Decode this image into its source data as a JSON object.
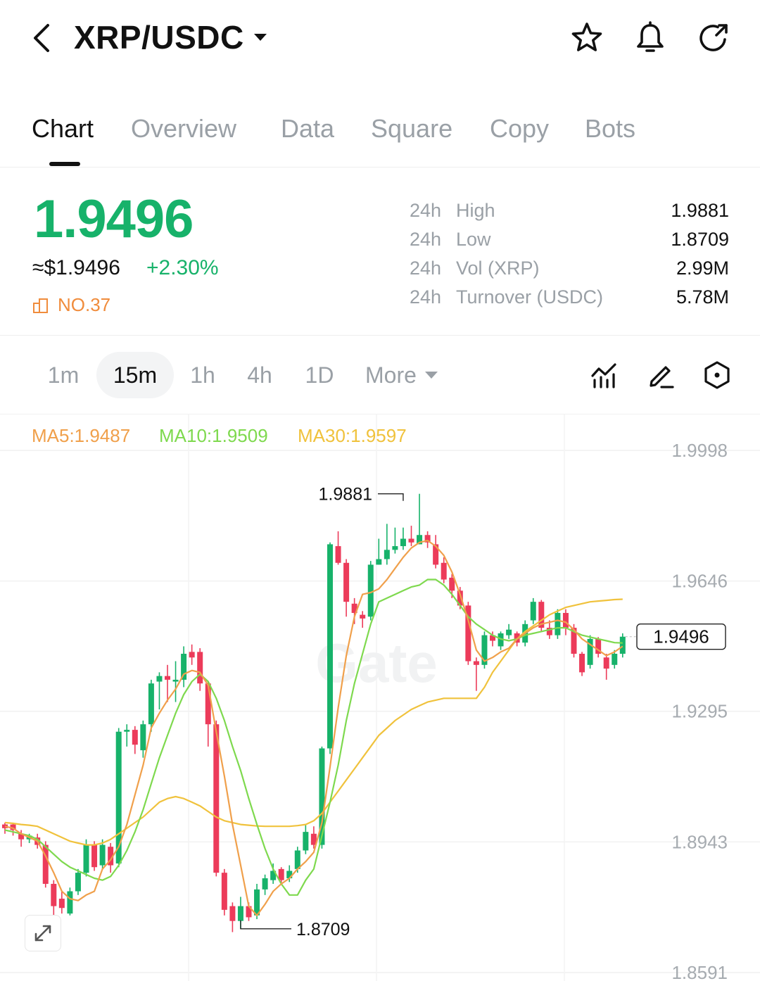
{
  "header": {
    "pair": "XRP/USDC",
    "icons": [
      "back-chevron-icon",
      "star-icon",
      "bell-icon",
      "share-icon"
    ]
  },
  "tabs": [
    {
      "label": "Chart",
      "active": true
    },
    {
      "label": "Overview",
      "active": false
    },
    {
      "label": "Data",
      "active": false
    },
    {
      "label": "Square",
      "active": false
    },
    {
      "label": "Copy",
      "active": false
    },
    {
      "label": "Bots",
      "active": false
    }
  ],
  "ticker": {
    "last_price": "1.9496",
    "usd_price": "≈$1.9496",
    "change": "+2.30%",
    "rank": "NO.37",
    "stats": [
      {
        "period": "24h",
        "label": "High",
        "value": "1.9881"
      },
      {
        "period": "24h",
        "label": "Low",
        "value": "1.8709"
      },
      {
        "period": "24h",
        "label": "Vol (XRP)",
        "value": "2.99M"
      },
      {
        "period": "24h",
        "label": "Turnover (USDC)",
        "value": "5.78M"
      }
    ]
  },
  "intervals": {
    "items": [
      {
        "label": "1m",
        "active": false
      },
      {
        "label": "15m",
        "active": true
      },
      {
        "label": "1h",
        "active": false
      },
      {
        "label": "4h",
        "active": false
      },
      {
        "label": "1D",
        "active": false
      }
    ],
    "more_label": "More",
    "tool_icons": [
      "indicator-icon",
      "draw-pencil-icon",
      "settings-hexagon-icon"
    ]
  },
  "colors": {
    "up": "#17b26a",
    "down": "#ec3b5a",
    "accent_green": "#17b26a",
    "rank_orange": "#f08c3c",
    "ma5": "#f0a04b",
    "ma10": "#7ed94e",
    "ma30": "#f0c23c"
  },
  "chart_data": {
    "type": "candlestick",
    "interval": "15m",
    "indicators": [
      {
        "name": "MA5",
        "label": "MA5:1.9487",
        "value": 1.9487
      },
      {
        "name": "MA10",
        "label": "MA10:1.9509",
        "value": 1.9509
      },
      {
        "name": "MA30",
        "label": "MA30:1.9597",
        "value": 1.9597
      }
    ],
    "y_ticks": [
      "1.9998",
      "1.9646",
      "1.9295",
      "1.8943",
      "1.8591"
    ],
    "ylim": [
      1.8591,
      1.9998
    ],
    "high_label": "1.9881",
    "high_value": 1.9881,
    "high_index": 49,
    "low_label": "1.8709",
    "low_value": 1.8709,
    "low_index": 29,
    "last_price_label": "1.9496",
    "last_price": 1.9496,
    "grid": true,
    "watermark": "Gate",
    "candles": [
      [
        1.899,
        1.898,
        1.8995,
        1.8965
      ],
      [
        1.899,
        1.8975,
        1.8995,
        1.896
      ],
      [
        1.8965,
        1.895,
        1.8975,
        1.893
      ],
      [
        1.895,
        1.896,
        1.8965,
        1.894
      ],
      [
        1.8955,
        1.8935,
        1.8965,
        1.8925
      ],
      [
        1.8935,
        1.883,
        1.8945,
        1.882
      ],
      [
        1.883,
        1.877,
        1.884,
        1.8735
      ],
      [
        1.879,
        1.8765,
        1.881,
        1.875
      ],
      [
        1.875,
        1.881,
        1.882,
        1.8745
      ],
      [
        1.881,
        1.886,
        1.887,
        1.88
      ],
      [
        1.886,
        1.8935,
        1.895,
        1.885
      ],
      [
        1.8935,
        1.8875,
        1.8945,
        1.8865
      ],
      [
        1.888,
        1.8935,
        1.895,
        1.887
      ],
      [
        1.893,
        1.888,
        1.894,
        1.886
      ],
      [
        1.8885,
        1.924,
        1.925,
        1.8875
      ],
      [
        1.924,
        1.9245,
        1.926,
        1.92
      ],
      [
        1.9245,
        1.9205,
        1.9255,
        1.918
      ],
      [
        1.919,
        1.926,
        1.927,
        1.917
      ],
      [
        1.926,
        1.937,
        1.938,
        1.924
      ],
      [
        1.9375,
        1.939,
        1.94,
        1.93
      ],
      [
        1.939,
        1.938,
        1.942,
        1.932
      ],
      [
        1.9375,
        1.938,
        1.943,
        1.932
      ],
      [
        1.938,
        1.945,
        1.947,
        1.936
      ],
      [
        1.9455,
        1.944,
        1.9475,
        1.942
      ],
      [
        1.9455,
        1.937,
        1.9465,
        1.935
      ],
      [
        1.937,
        1.926,
        1.9375,
        1.92
      ],
      [
        1.926,
        1.886,
        1.927,
        1.885
      ],
      [
        1.886,
        1.876,
        1.887,
        1.8745
      ],
      [
        1.877,
        1.873,
        1.878,
        1.87
      ],
      [
        1.873,
        1.877,
        1.8795,
        1.8709
      ],
      [
        1.877,
        1.874,
        1.878,
        1.873
      ],
      [
        1.8745,
        1.8815,
        1.883,
        1.8735
      ],
      [
        1.8815,
        1.8845,
        1.8855,
        1.88
      ],
      [
        1.884,
        1.8865,
        1.8885,
        1.883
      ],
      [
        1.887,
        1.884,
        1.8875,
        1.883
      ],
      [
        1.8845,
        1.8865,
        1.888,
        1.8835
      ],
      [
        1.887,
        1.892,
        1.893,
        1.886
      ],
      [
        1.892,
        1.897,
        1.899,
        1.891
      ],
      [
        1.8965,
        1.8935,
        1.8985,
        1.8925
      ],
      [
        1.8935,
        1.9195,
        1.92,
        1.8925
      ],
      [
        1.9195,
        1.9745,
        1.975,
        1.918
      ],
      [
        1.974,
        1.9695,
        1.978,
        1.969
      ],
      [
        1.9695,
        1.959,
        1.9705,
        1.955
      ],
      [
        1.9585,
        1.956,
        1.96,
        1.953
      ],
      [
        1.9555,
        1.9545,
        1.9565,
        1.952
      ],
      [
        1.955,
        1.969,
        1.97,
        1.954
      ],
      [
        1.969,
        1.9705,
        1.976,
        1.969
      ],
      [
        1.9705,
        1.973,
        1.98,
        1.969
      ],
      [
        1.973,
        1.974,
        1.979,
        1.972
      ],
      [
        1.974,
        1.976,
        1.979,
        1.973
      ],
      [
        1.976,
        1.975,
        1.9795,
        1.974
      ],
      [
        1.9745,
        1.977,
        1.9881,
        1.9745
      ],
      [
        1.977,
        1.975,
        1.978,
        1.9735
      ],
      [
        1.9745,
        1.969,
        1.977,
        1.968
      ],
      [
        1.9695,
        1.965,
        1.971,
        1.964
      ],
      [
        1.9655,
        1.962,
        1.9665,
        1.96
      ],
      [
        1.962,
        1.958,
        1.963,
        1.957
      ],
      [
        1.958,
        1.943,
        1.959,
        1.942
      ],
      [
        1.943,
        1.942,
        1.944,
        1.935
      ],
      [
        1.942,
        1.95,
        1.951,
        1.941
      ],
      [
        1.95,
        1.9485,
        1.951,
        1.947
      ],
      [
        1.947,
        1.9505,
        1.951,
        1.946
      ],
      [
        1.95,
        1.9515,
        1.953,
        1.949
      ],
      [
        1.9505,
        1.948,
        1.951,
        1.947
      ],
      [
        1.948,
        1.953,
        1.954,
        1.947
      ],
      [
        1.954,
        1.959,
        1.96,
        1.953
      ],
      [
        1.959,
        1.952,
        1.9595,
        1.951
      ],
      [
        1.952,
        1.95,
        1.954,
        1.949
      ],
      [
        1.95,
        1.956,
        1.957,
        1.949
      ],
      [
        1.956,
        1.952,
        1.957,
        1.95
      ],
      [
        1.952,
        1.945,
        1.953,
        1.944
      ],
      [
        1.945,
        1.94,
        1.9455,
        1.939
      ],
      [
        1.942,
        1.949,
        1.95,
        1.941
      ],
      [
        1.949,
        1.945,
        1.9495,
        1.944
      ],
      [
        1.944,
        1.941,
        1.945,
        1.938
      ],
      [
        1.942,
        1.945,
        1.946,
        1.941
      ],
      [
        1.945,
        1.9496,
        1.9505,
        1.944
      ]
    ],
    "ma5_series": [
      1.8985,
      1.898,
      1.8965,
      1.8955,
      1.8945,
      1.8905,
      1.886,
      1.881,
      1.879,
      1.8785,
      1.88,
      1.881,
      1.887,
      1.8895,
      1.893,
      1.899,
      1.907,
      1.915,
      1.925,
      1.929,
      1.9325,
      1.9355,
      1.9395,
      1.9405,
      1.94,
      1.9365,
      1.924,
      1.912,
      1.899,
      1.888,
      1.877,
      1.8745,
      1.8775,
      1.881,
      1.883,
      1.8845,
      1.887,
      1.889,
      1.8915,
      1.8995,
      1.9145,
      1.9305,
      1.9445,
      1.955,
      1.961,
      1.9615,
      1.9625,
      1.965,
      1.968,
      1.971,
      1.9735,
      1.975,
      1.9755,
      1.974,
      1.9715,
      1.967,
      1.961,
      1.954,
      1.946,
      1.943,
      1.944,
      1.9455,
      1.9465,
      1.949,
      1.9505,
      1.952,
      1.953,
      1.9535,
      1.954,
      1.9535,
      1.9515,
      1.949,
      1.9475,
      1.946,
      1.9445,
      1.9455,
      1.947
    ],
    "ma10_series": [
      1.8975,
      1.897,
      1.8965,
      1.896,
      1.895,
      1.893,
      1.891,
      1.889,
      1.8875,
      1.8865,
      1.8855,
      1.8845,
      1.884,
      1.885,
      1.888,
      1.892,
      1.897,
      1.903,
      1.91,
      1.917,
      1.923,
      1.929,
      1.934,
      1.9375,
      1.9395,
      1.9375,
      1.933,
      1.927,
      1.92,
      1.9135,
      1.906,
      1.899,
      1.8925,
      1.887,
      1.883,
      1.88,
      1.88,
      1.884,
      1.887,
      1.896,
      1.905,
      1.915,
      1.927,
      1.937,
      1.945,
      1.953,
      1.959,
      1.96,
      1.961,
      1.962,
      1.963,
      1.9635,
      1.965,
      1.965,
      1.9635,
      1.961,
      1.958,
      1.955,
      1.953,
      1.9515,
      1.95,
      1.949,
      1.9485,
      1.949,
      1.95,
      1.9505,
      1.951,
      1.9515,
      1.952,
      1.952,
      1.951,
      1.95,
      1.9495,
      1.949,
      1.9485,
      1.948,
      1.9479
    ],
    "ma30_series": [
      1.8995,
      1.8993,
      1.899,
      1.8988,
      1.8985,
      1.8975,
      1.8965,
      1.8955,
      1.8945,
      1.894,
      1.8935,
      1.8935,
      1.894,
      1.895,
      1.8965,
      1.898,
      1.8995,
      1.901,
      1.903,
      1.905,
      1.906,
      1.9065,
      1.906,
      1.905,
      1.904,
      1.9025,
      1.901,
      1.9,
      1.8995,
      1.899,
      1.8988,
      1.8986,
      1.8985,
      1.8985,
      1.8985,
      1.8985,
      1.8987,
      1.899,
      1.9,
      1.902,
      1.905,
      1.908,
      1.911,
      1.914,
      1.917,
      1.92,
      1.923,
      1.925,
      1.927,
      1.9285,
      1.93,
      1.931,
      1.932,
      1.9325,
      1.933,
      1.933,
      1.933,
      1.933,
      1.933,
      1.936,
      1.94,
      1.943,
      1.946,
      1.949,
      1.951,
      1.9525,
      1.954,
      1.9555,
      1.9565,
      1.9575,
      1.958,
      1.9585,
      1.959,
      1.9592,
      1.9594,
      1.9596,
      1.9597
    ]
  }
}
